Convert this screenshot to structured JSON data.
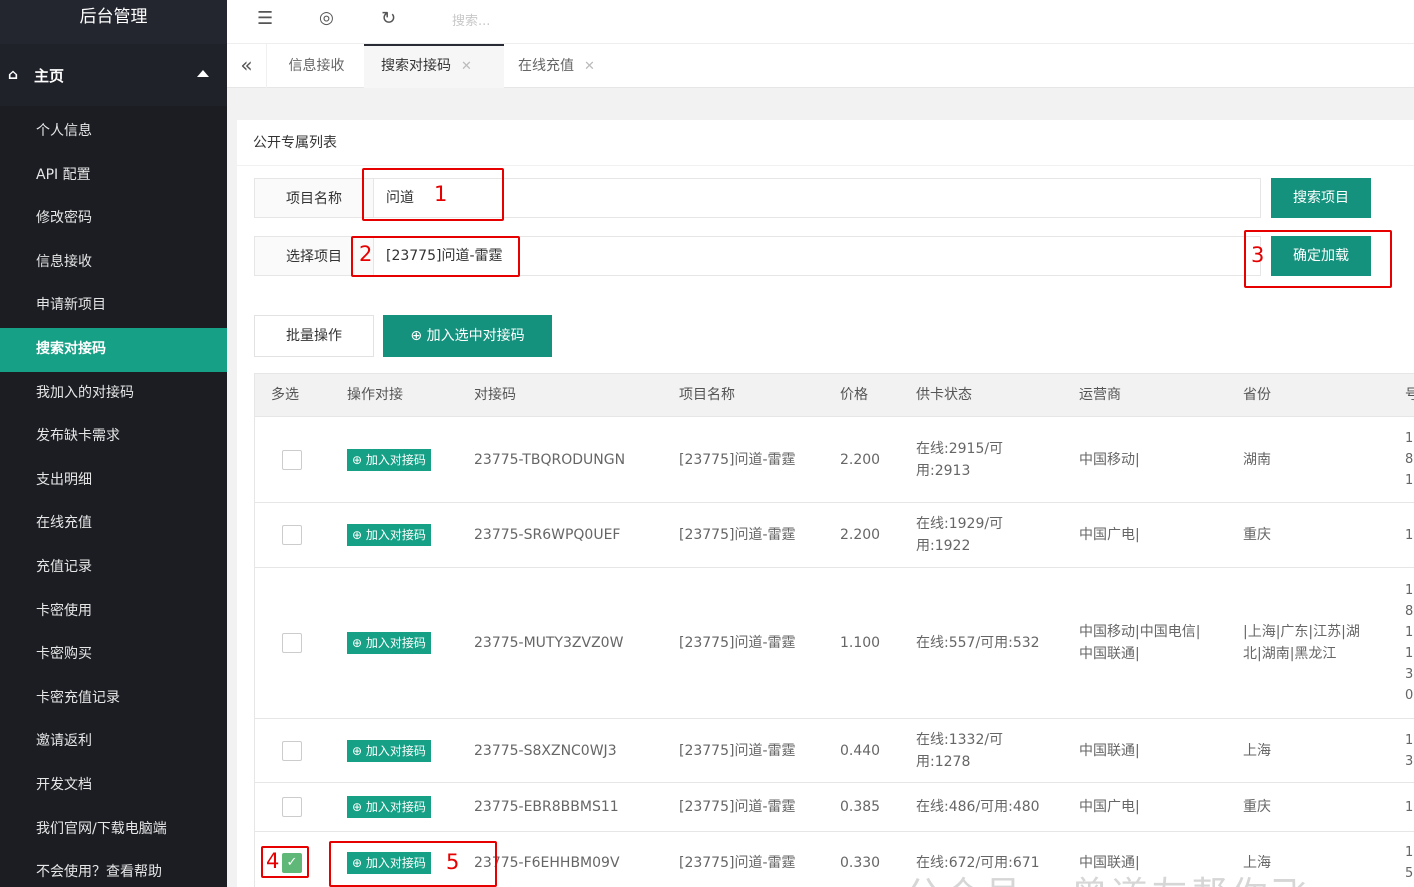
{
  "sidebar": {
    "brand": "后台管理",
    "home": "主页",
    "items": [
      {
        "label": "个人信息"
      },
      {
        "label": "API 配置"
      },
      {
        "label": "修改密码"
      },
      {
        "label": "信息接收"
      },
      {
        "label": "申请新项目"
      },
      {
        "label": "搜索对接码",
        "active": true
      },
      {
        "label": "我加入的对接码"
      },
      {
        "label": "发布缺卡需求"
      },
      {
        "label": "支出明细"
      },
      {
        "label": "在线充值"
      },
      {
        "label": "充值记录"
      },
      {
        "label": "卡密使用"
      },
      {
        "label": "卡密购买"
      },
      {
        "label": "卡密充值记录"
      },
      {
        "label": "邀请返利"
      },
      {
        "label": "开发文档"
      },
      {
        "label": "我们官网/下载电脑端"
      },
      {
        "label": "不会使用？查看帮助"
      }
    ]
  },
  "topbar": {
    "search_placeholder": "搜索..."
  },
  "tabs": [
    {
      "label": "信息接收"
    },
    {
      "label": "搜索对接码",
      "active": true
    },
    {
      "label": "在线充值"
    }
  ],
  "panel": {
    "title": "公开专属列表",
    "project_name_label": "项目名称",
    "project_name_value": "问道",
    "search_button": "搜索项目",
    "select_label": "选择项目",
    "select_value": "[23775]问道-雷霆",
    "confirm_button": "确定加载",
    "batch_button": "批量操作",
    "add_selected_button": "加入选中对接码"
  },
  "annotations": [
    "1",
    "2",
    "3",
    "4",
    "5"
  ],
  "table": {
    "headers": [
      "多选",
      "操作对接",
      "对接码",
      "项目名称",
      "价格",
      "供卡状态",
      "运营商",
      "省份",
      "号"
    ],
    "add_label": "加入对接码",
    "rows": [
      {
        "code": "23775-TBQRODUNGN",
        "project": "[23775]问道-雷霆",
        "price": "2.200",
        "status": "在线:2915/可用:2913",
        "status_lines": [
          "在线:2915/可",
          "用:2913"
        ],
        "carrier": "中国移动|",
        "carrier_lines": [
          "中国移动|"
        ],
        "province_lines": [
          "湖南"
        ],
        "extra": [
          "1",
          "8",
          "1"
        ],
        "checked": false
      },
      {
        "code": "23775-SR6WPQ0UEF",
        "project": "[23775]问道-雷霆",
        "price": "2.200",
        "status_lines": [
          "在线:1929/可",
          "用:1922"
        ],
        "carrier_lines": [
          "中国广电|"
        ],
        "province_lines": [
          "重庆"
        ],
        "extra": [
          "1"
        ],
        "checked": false
      },
      {
        "code": "23775-MUTY3ZVZ0W",
        "project": "[23775]问道-雷霆",
        "price": "1.100",
        "status_lines": [
          "在线:557/可用:532"
        ],
        "carrier_lines": [
          "中国移动|中国电信|",
          "中国联通|"
        ],
        "province_lines": [
          "|上海|广东|江苏|湖",
          "北|湖南|黑龙江"
        ],
        "extra": [
          "1",
          "8",
          "1",
          "1",
          "3",
          "0"
        ],
        "checked": false
      },
      {
        "code": "23775-S8XZNC0WJ3",
        "project": "[23775]问道-雷霆",
        "price": "0.440",
        "status_lines": [
          "在线:1332/可",
          "用:1278"
        ],
        "carrier_lines": [
          "中国联通|"
        ],
        "province_lines": [
          "上海"
        ],
        "extra": [
          "1",
          "3"
        ],
        "checked": false
      },
      {
        "code": "23775-EBR8BBMS11",
        "project": "[23775]问道-雷霆",
        "price": "0.385",
        "status_lines": [
          "在线:486/可用:480"
        ],
        "carrier_lines": [
          "中国广电|"
        ],
        "province_lines": [
          "重庆"
        ],
        "extra": [
          "1"
        ],
        "checked": false
      },
      {
        "code": "23775-F6EHHBM09V",
        "project": "[23775]问道-雷霆",
        "price": "0.330",
        "status_lines": [
          "在线:672/可用:671"
        ],
        "carrier_lines": [
          "中国联通|"
        ],
        "province_lines": [
          "上海"
        ],
        "extra": [
          "1",
          "5"
        ],
        "checked": true
      }
    ]
  },
  "watermark": "公众号 · 曾道友帮你飞"
}
